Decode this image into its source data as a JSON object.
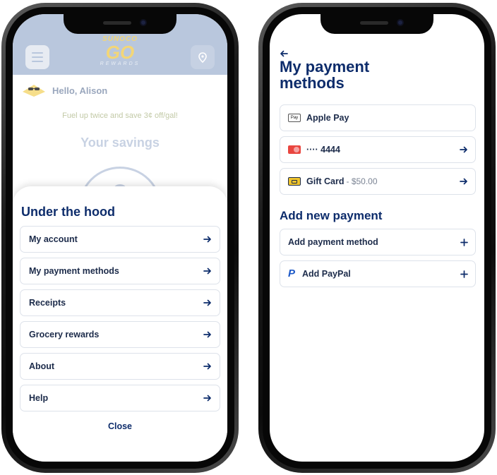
{
  "left_screen": {
    "header": {
      "logo_top": "SUNOCO",
      "logo_main": "GO",
      "logo_bottom": "REWARDS"
    },
    "greeting": "Hello, Alison",
    "promo": "Fuel up twice and save 3¢ off/gal!",
    "savings_title": "Your savings",
    "sheet": {
      "title": "Under the hood",
      "items": [
        {
          "label": "My account"
        },
        {
          "label": "My payment methods"
        },
        {
          "label": "Receipts"
        },
        {
          "label": "Grocery rewards"
        },
        {
          "label": "About"
        },
        {
          "label": "Help"
        }
      ],
      "close_label": "Close"
    }
  },
  "right_screen": {
    "title": "My payment methods",
    "methods": [
      {
        "icon": "apple-pay-icon",
        "badge": "Pay",
        "label": "Apple Pay",
        "sub": "",
        "arrow": false
      },
      {
        "icon": "mastercard-icon",
        "label": "···· 4444",
        "sub": "",
        "arrow": true
      },
      {
        "icon": "gift-card-icon",
        "label": "Gift Card",
        "sub": "- $50.00",
        "arrow": true
      }
    ],
    "add_section_title": "Add new payment",
    "add_options": [
      {
        "icon": "",
        "label": "Add payment method"
      },
      {
        "icon": "paypal-icon",
        "label": "Add PayPal"
      }
    ]
  },
  "colors": {
    "brand_navy": "#0d2c6b",
    "header_blue": "#b9c7dd",
    "logo_yellow": "#f3d677"
  }
}
